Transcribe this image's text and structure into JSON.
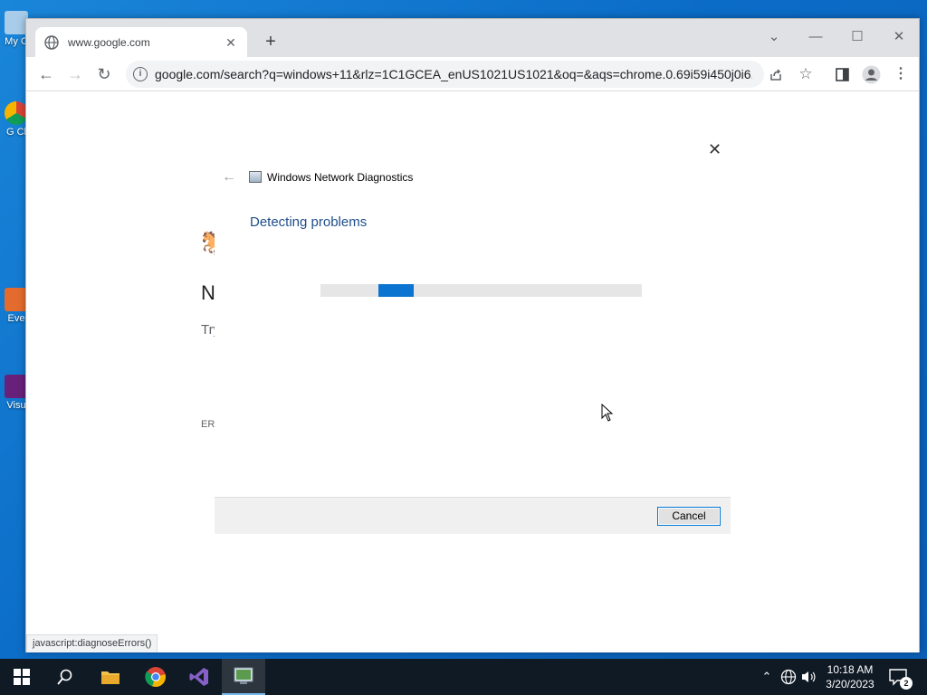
{
  "desktop": {
    "icons": [
      {
        "label": "My C"
      },
      {
        "label": "G Cl"
      },
      {
        "label": "Eve"
      },
      {
        "label": "Visu"
      }
    ]
  },
  "browser": {
    "tab": {
      "title": "www.google.com",
      "close": "✕"
    },
    "new_tab": "+",
    "window_controls": {
      "dropdown": "⌄",
      "minimize": "—",
      "maximize": "☐",
      "close": "✕"
    },
    "nav": {
      "back": "←",
      "forward": "→",
      "reload": "↻"
    },
    "url": "google.com/search?q=windows+11&rlz=1C1GCEA_enUS1021US1021&oq=&aqs=chrome.0.69i59i450j0i6...",
    "status_bar": "javascript:diagnoseErrors()",
    "error_page_fragments": {
      "glyph": "🐎",
      "heading": "N",
      "hint": "Try",
      "code": "ERR"
    }
  },
  "dialog": {
    "app_title": "Windows Network Diagnostics",
    "heading": "Detecting problems",
    "progress": {
      "indeterminate": true,
      "fill_start_fraction": 0.18
    },
    "cancel_label": "Cancel",
    "close": "✕",
    "back": "←"
  },
  "taskbar": {
    "clock_time": "10:18 AM",
    "clock_date": "3/20/2023",
    "notification_count": "2",
    "apps": [
      "start",
      "search",
      "file-explorer",
      "chrome",
      "visual-studio",
      "network-diagnostics"
    ]
  },
  "colors": {
    "accent": "#0078d7",
    "progress_fill": "#0b74d1",
    "heading_blue": "#1e4e8c",
    "taskbar": "#101a25"
  }
}
